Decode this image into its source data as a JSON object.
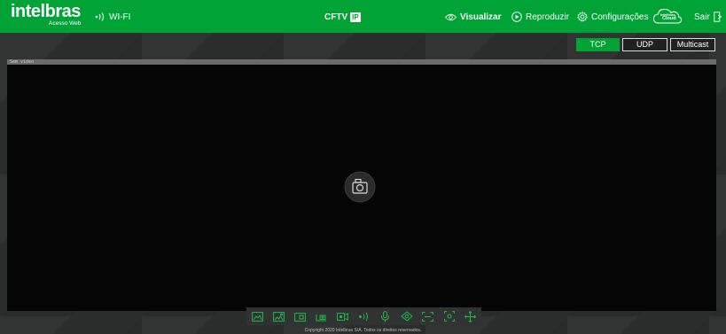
{
  "header": {
    "brand": "intelbras",
    "brand_sub": "Acesso Web",
    "wifi_label": "WI-FI",
    "center_title": "CFTV",
    "center_badge": "IP",
    "nav": {
      "visualizar": "Visualizar",
      "reproduzir": "Reproduzir",
      "configuracoes": "Configurações",
      "cloud_label_1": "Intelbras",
      "cloud_label_2": "Cloud",
      "sair": "Sair"
    },
    "colors": {
      "accent": "#00a335"
    }
  },
  "protocol_tabs": {
    "selected": "TCP",
    "tcp": "TCP",
    "udp": "UDP",
    "multicast": "Multicast"
  },
  "video": {
    "status_text": "Sem vídeo",
    "center_icon": "camera-icon"
  },
  "toolbar": {
    "icons": [
      "image-adjust-icon",
      "image-compare-icon",
      "window-icon",
      "snapshot-icon",
      "record-icon",
      "audio-icon",
      "microphone-icon",
      "zoom-icon",
      "fullscreen-icon",
      "focus-icon",
      "ptz-icon"
    ]
  },
  "footer": {
    "text": "Copyright 2020 Intelbras S/A. Todos os direitos reservados."
  }
}
